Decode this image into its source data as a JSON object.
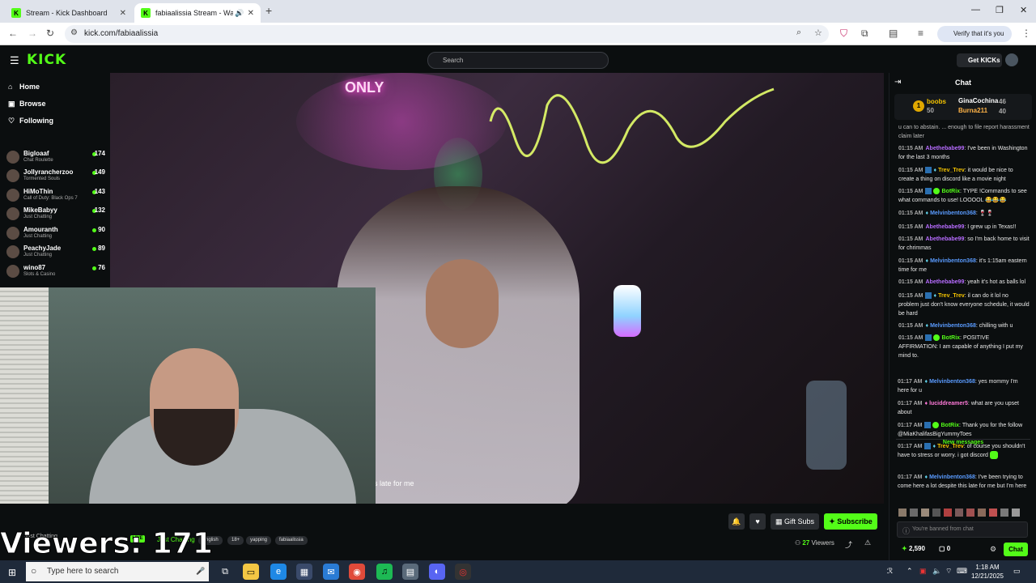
{
  "browser": {
    "tabs": [
      {
        "title": "Stream - Kick Dashboard"
      },
      {
        "title": "fabiaalissia Stream - Watch"
      }
    ],
    "url": "kick.com/fabiaalissia",
    "verify_label": "Verify that it's you"
  },
  "kick": {
    "logo": "KICK",
    "search_placeholder": "Search",
    "get_kicks": "Get KICKs",
    "nav": [
      {
        "label": "Home",
        "icon": "home-icon"
      },
      {
        "label": "Browse",
        "icon": "browse-icon"
      },
      {
        "label": "Following",
        "icon": "heart-icon"
      }
    ],
    "following": [
      {
        "name": "Bigloaaf",
        "category": "Chat Roulette",
        "viewers": "174"
      },
      {
        "name": "Jollyrancherzoo",
        "category": "Tormented Souls",
        "viewers": "149"
      },
      {
        "name": "HiMoThin",
        "category": "Call of Duty: Black Ops 7",
        "viewers": "143"
      },
      {
        "name": "MikeBabyy",
        "category": "Just Chatting",
        "viewers": "132"
      },
      {
        "name": "Amouranth",
        "category": "Just Chatting",
        "viewers": "90"
      },
      {
        "name": "PeachyJade",
        "category": "Just Chatting",
        "viewers": "89"
      },
      {
        "name": "wino87",
        "category": "Slots & Casino",
        "viewers": "76"
      }
    ]
  },
  "video": {
    "caption": "s late for me",
    "neon_sign": "ONLY"
  },
  "overlay": {
    "viewers_text": "Viewers: 171",
    "just_chatting_small": "Just Chatting",
    "live_badge": "LIVE",
    "category_green": "Just Chatting",
    "tags": [
      "English",
      "18+",
      "yapping",
      "fabiaalissia"
    ]
  },
  "actions": {
    "gift_subs": "Gift Subs",
    "subscribe": "Subscribe",
    "viewers_count": "27",
    "viewers_label": "Viewers"
  },
  "chat": {
    "title": "Chat",
    "gifters": [
      {
        "name": "boobs",
        "amount": "50"
      },
      {
        "name": "GinaCochina",
        "amount": "46"
      },
      {
        "name": "Burna211",
        "amount": "40"
      }
    ],
    "partial_top": "u can to abstain. ... enough to file report harassment claim later",
    "messages": [
      {
        "time": "01:15 AM",
        "user": "Abethebabe99",
        "color": "#b76cff",
        "text": "I've been in Washington for the last 3 months"
      },
      {
        "time": "01:15 AM",
        "user": "Trev_Trev",
        "color": "#f5c400",
        "text": "it would be nice to create a thing on discord like a movie night"
      },
      {
        "time": "01:15 AM",
        "user": "BotRix",
        "color": "#53fc18",
        "text": "TYPE !Commands to see what commands to use! LOOOOL 😂😂😂"
      },
      {
        "time": "01:15 AM",
        "user": "Melvinbenton368",
        "color": "#5a9bff",
        "text": "🍷🍷"
      },
      {
        "time": "01:15 AM",
        "user": "Abethebabe99",
        "color": "#b76cff",
        "text": "I grew up in Texas!!"
      },
      {
        "time": "01:15 AM",
        "user": "Abethebabe99",
        "color": "#b76cff",
        "text": "so I'm back home to visit for chrimmas"
      },
      {
        "time": "01:15 AM",
        "user": "Melvinbenton368",
        "color": "#5a9bff",
        "text": "it's 1:15am eastern time for me"
      },
      {
        "time": "01:15 AM",
        "user": "Abethebabe99",
        "color": "#b76cff",
        "text": "yeah it's hot as balls lol"
      },
      {
        "time": "01:15 AM",
        "user": "Trev_Trev",
        "color": "#f5c400",
        "text": "il can do it lol no problem just don't know everyone schedule, it would be hard"
      },
      {
        "time": "01:15 AM",
        "user": "Melvinbenton368",
        "color": "#5a9bff",
        "text": "chilling with u"
      },
      {
        "time": "01:15 AM",
        "user": "BotRix",
        "color": "#53fc18",
        "text": "POSITIVE AFFIRMATION: I am capable of anything I put my mind to."
      }
    ],
    "new_messages_label": "New messages",
    "new_messages": [
      {
        "time": "01:17 AM",
        "user": "Melvinbenton368",
        "color": "#5a9bff",
        "text": "yes mommy I'm here for u"
      },
      {
        "time": "01:17 AM",
        "user": "luciddreamer5",
        "color": "#ff7ad9",
        "text": "what are you upset about"
      },
      {
        "time": "01:17 AM",
        "user": "BotRix",
        "color": "#53fc18",
        "text": "Thank you for the follow @MiaKhalifasBigYummyToes"
      },
      {
        "time": "01:17 AM",
        "user": "Trev_Trev",
        "color": "#f5c400",
        "text": "of course you shouldn't have to stress or worry. i got discord"
      },
      {
        "time": "01:17 AM",
        "user": "Melvinbenton368",
        "color": "#5a9bff",
        "text": "I've been trying to come here a lot despite this late for me but I'm here"
      }
    ],
    "banned_placeholder": "You're banned from chat",
    "kicks_balance": "2,590",
    "gift_count": "0",
    "chat_button": "Chat"
  },
  "taskbar": {
    "search_placeholder": "Type here to search",
    "time": "1:18 AM",
    "date": "12/21/2025"
  }
}
